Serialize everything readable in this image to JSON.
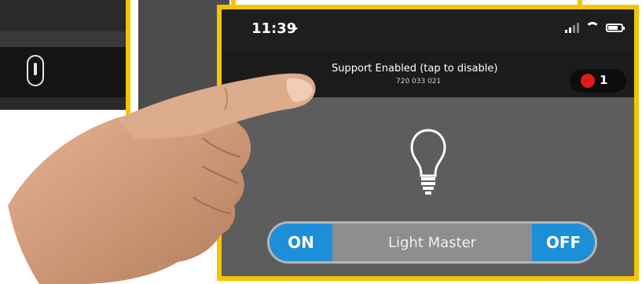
{
  "status_bar": {
    "time": "11:39"
  },
  "support_banner": {
    "title": "Support Enabled (tap to disable)",
    "number": "720 033 021"
  },
  "alert_badge": {
    "count": "1",
    "color": "#e01b1b"
  },
  "light_control": {
    "icon": "lightbulb-icon",
    "label": "Light Master",
    "on_label": "ON",
    "off_label": "OFF",
    "accent": "#1d8fd8"
  },
  "background_device": {
    "icon": "thermometer-icon"
  },
  "frame_color": "#f5c400"
}
